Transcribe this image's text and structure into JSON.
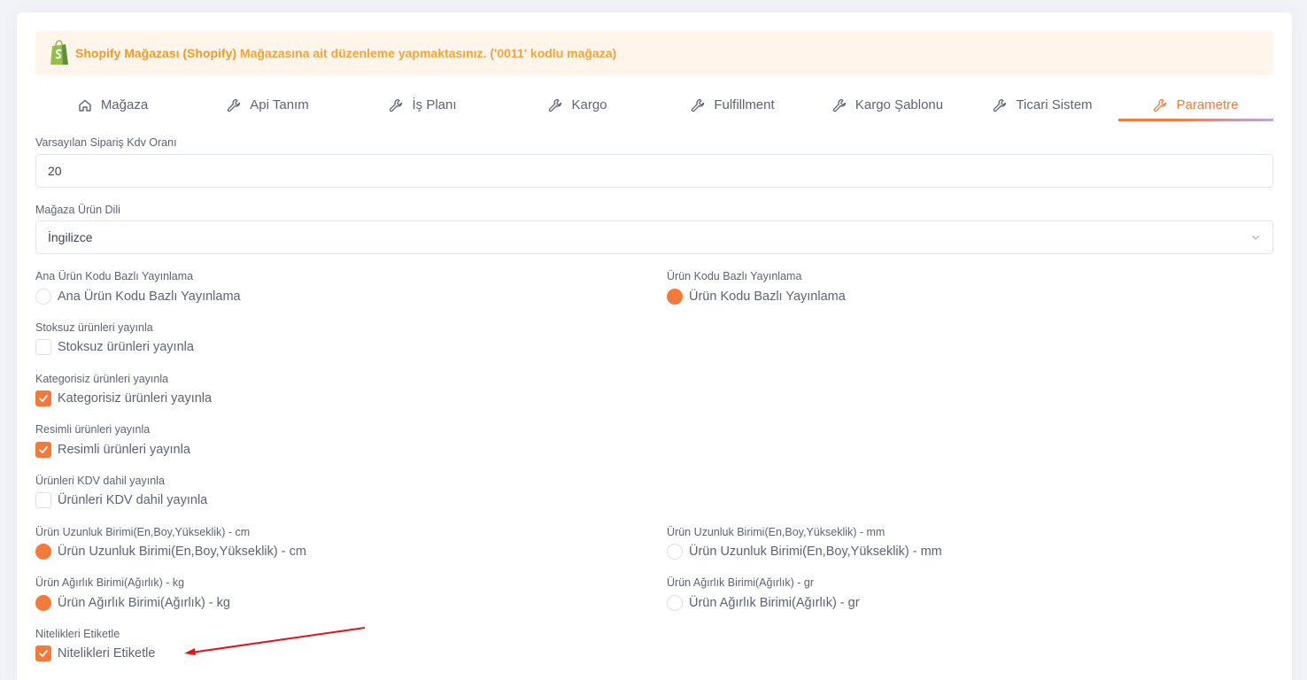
{
  "notice": {
    "store_name": "Shopify Mağazası (Shopify)",
    "message": " Mağazasına ait düzenleme yapmaktasınız. ('0011' kodlu mağaza)"
  },
  "tabs": [
    {
      "label": "Mağaza",
      "icon": "home-icon"
    },
    {
      "label": "Api Tanım",
      "icon": "wrench-icon"
    },
    {
      "label": "İş Planı",
      "icon": "wrench-icon"
    },
    {
      "label": "Kargo",
      "icon": "wrench-icon"
    },
    {
      "label": "Fulfillment",
      "icon": "wrench-icon"
    },
    {
      "label": "Kargo Şablonu",
      "icon": "wrench-icon"
    },
    {
      "label": "Ticari Sistem",
      "icon": "wrench-icon"
    },
    {
      "label": "Parametre",
      "icon": "wrench-icon",
      "active": true
    }
  ],
  "form": {
    "vat_label": "Varsayılan Sipariş Kdv Oranı",
    "vat_value": "20",
    "language_label": "Mağaza Ürün Dili",
    "language_value": "İngilizce",
    "main_code_label": "Ana Ürün Kodu Bazlı Yayınlama",
    "main_code_option": "Ana Ürün Kodu Bazlı Yayınlama",
    "code_label": "Ürün Kodu Bazlı Yayınlama",
    "code_option": "Ürün Kodu Bazlı Yayınlama",
    "no_stock_label": "Stoksuz ürünleri yayınla",
    "no_stock_option": "Stoksuz ürünleri yayınla",
    "no_category_label": "Kategorisiz ürünleri yayınla",
    "no_category_option": "Kategorisiz ürünleri yayınla",
    "with_image_label": "Resimli ürünleri yayınla",
    "with_image_option": "Resimli ürünleri yayınla",
    "vat_included_label": "Ürünleri KDV dahil yayınla",
    "vat_included_option": "Ürünleri KDV dahil yayınla",
    "length_cm_label": "Ürün Uzunluk Birimi(En,Boy,Yükseklik) - cm",
    "length_cm_option": "Ürün Uzunluk Birimi(En,Boy,Yükseklik) - cm",
    "length_mm_label": "Ürün Uzunluk Birimi(En,Boy,Yükseklik) - mm",
    "length_mm_option": "Ürün Uzunluk Birimi(En,Boy,Yükseklik) - mm",
    "weight_kg_label": "Ürün Ağırlık Birimi(Ağırlık) - kg",
    "weight_kg_option": "Ürün Ağırlık Birimi(Ağırlık) - kg",
    "weight_gr_label": "Ürün Ağırlık Birimi(Ağırlık) - gr",
    "weight_gr_option": "Ürün Ağırlık Birimi(Ağırlık) - gr",
    "tag_attrs_label": "Nitelikleri Etiketle",
    "tag_attrs_option": "Nitelikleri Etiketle"
  },
  "colors": {
    "accent": "#f37a3b",
    "notice_bg": "#fff5ea",
    "notice_text": "#f7a33b",
    "annotation_arrow": "#e0161b"
  }
}
